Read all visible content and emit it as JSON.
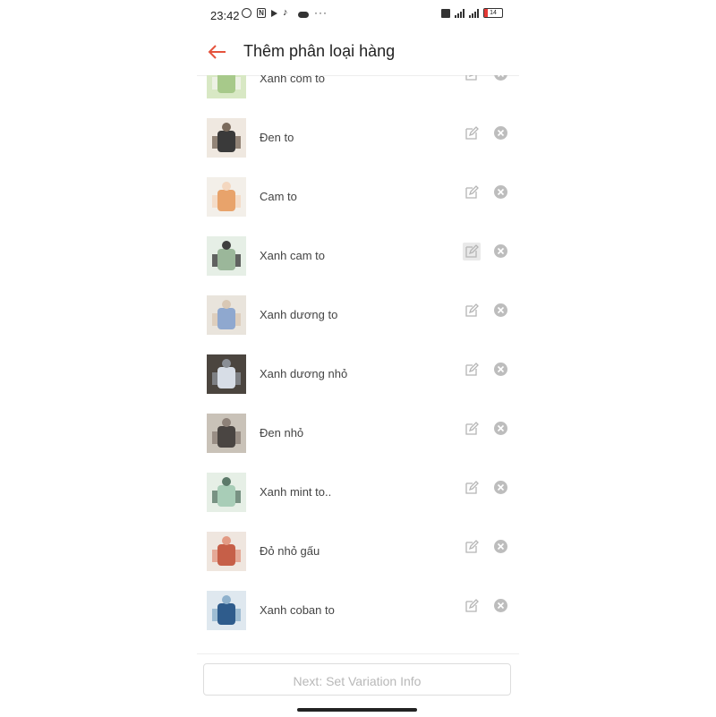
{
  "status_bar": {
    "time": "23:42",
    "battery": "14",
    "icons_left": [
      "alarm-icon",
      "nfc-icon",
      "play-icon",
      "tiktok-icon",
      "cloud-icon",
      "more-dots-icon"
    ],
    "icons_right": [
      "sim-icon",
      "signal-icon",
      "signal-icon",
      "battery-icon"
    ]
  },
  "header": {
    "title": "Thêm phân loại hàng",
    "back_icon": "arrow-left-icon",
    "accent_color": "#e5533d"
  },
  "variations": [
    {
      "label": "Xanh cốm to",
      "thumb_colors": [
        "#d8e8c4",
        "#a7c98a",
        "#f2f2ec"
      ]
    },
    {
      "label": "Đen to",
      "thumb_colors": [
        "#efe8e0",
        "#3a3a3a",
        "#7a6a5c"
      ]
    },
    {
      "label": "Cam to",
      "thumb_colors": [
        "#f3efe9",
        "#e8a36b",
        "#f4d7bf"
      ]
    },
    {
      "label": "Xanh cam to",
      "thumb_colors": [
        "#e6efe6",
        "#9bb79a",
        "#3f3f3f"
      ],
      "edit_active": true
    },
    {
      "label": "Xanh dương to",
      "thumb_colors": [
        "#e9e4dc",
        "#8fa8cf",
        "#d9c8b5"
      ]
    },
    {
      "label": "Xanh dương nhỏ",
      "thumb_colors": [
        "#4b453f",
        "#d7dde6",
        "#8b8f96"
      ]
    },
    {
      "label": "Đen nhỏ",
      "thumb_colors": [
        "#c9c2b8",
        "#4a4542",
        "#8d8178"
      ]
    },
    {
      "label": "Xanh mint to..",
      "thumb_colors": [
        "#e6efe6",
        "#a8cdb7",
        "#5c7a6a"
      ]
    },
    {
      "label": "Đỏ nhỏ gấu",
      "thumb_colors": [
        "#efe6df",
        "#c65f48",
        "#e29a84"
      ]
    },
    {
      "label": "Xanh coban to",
      "thumb_colors": [
        "#dfe8ef",
        "#2f5c8c",
        "#8fb1cc"
      ]
    }
  ],
  "footer": {
    "next_label": "Next: Set Variation Info"
  },
  "icons": {
    "edit": "edit-icon",
    "remove": "remove-icon"
  }
}
